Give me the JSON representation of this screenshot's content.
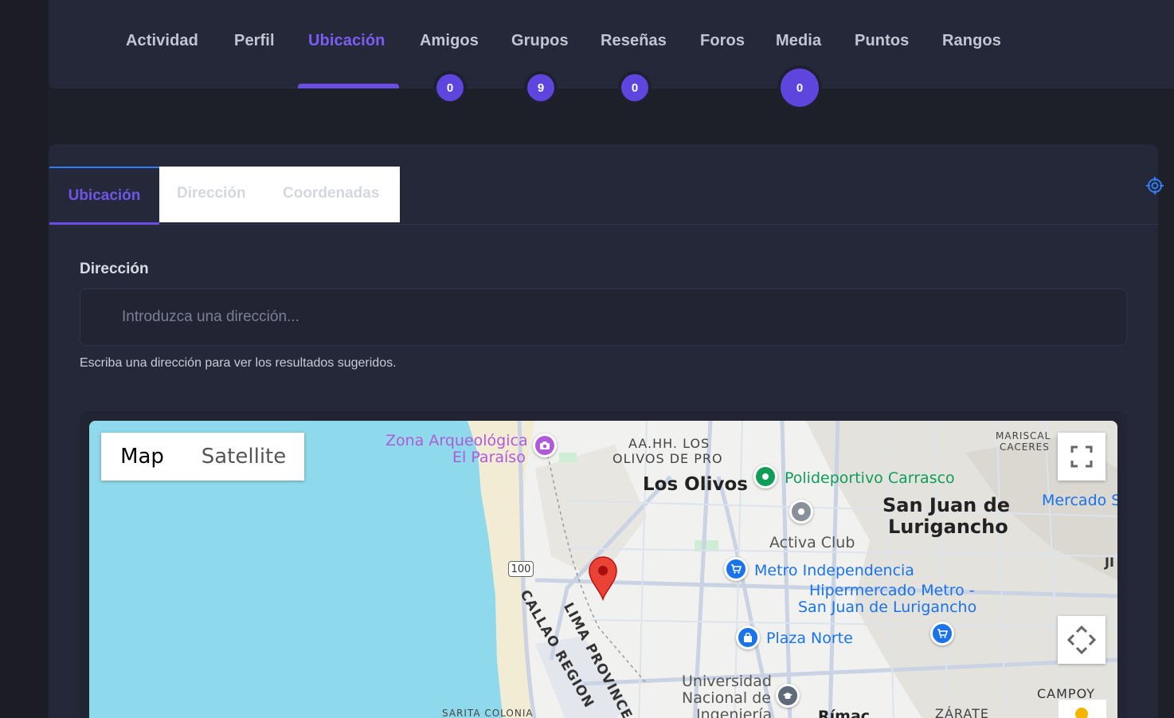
{
  "nav": {
    "items": [
      {
        "label": "Actividad"
      },
      {
        "label": "Perfil"
      },
      {
        "label": "Ubicación",
        "active": true
      },
      {
        "label": "Amigos",
        "badge": "0"
      },
      {
        "label": "Grupos",
        "badge": "9"
      },
      {
        "label": "Reseñas",
        "badge": "0"
      },
      {
        "label": "Foros"
      },
      {
        "label": "Media",
        "badge": "0"
      },
      {
        "label": "Puntos"
      },
      {
        "label": "Rangos"
      }
    ]
  },
  "location_tabs": {
    "active": "Ubicación",
    "items": [
      "Ubicación",
      "Dirección",
      "Coordenadas"
    ]
  },
  "form": {
    "address_label": "Dirección",
    "address_placeholder": "Introduzca una dirección...",
    "address_value": "",
    "help_text": "Escriba una dirección para ver los resultados sugeridos."
  },
  "map": {
    "type_buttons": [
      "Map",
      "Satellite"
    ],
    "selected_type": "Map",
    "labels": {
      "zona1": "Zona Arqueológica",
      "zona2": "El Paraíso",
      "aahh1": "AA.HH. LOS",
      "aahh2": "OLIVOS DE PRO",
      "los_olivos": "Los Olivos",
      "poli": "Polideportivo Carrasco",
      "sjl1": "San Juan de",
      "sjl2": "Lurigancho",
      "mariscal1": "MARISCAL",
      "mariscal2": "CACERES",
      "mercado": "Mercado S",
      "ji": "JI",
      "activa": "Activa Club",
      "metro_ind": "Metro Independencia",
      "hiper1": "Hipermercado Metro -",
      "hiper2": "San Juan de Lurigancho",
      "plaza": "Plaza Norte",
      "lima": "LIMA PROVINCE",
      "callao": "CALLAO REGION",
      "route": "100",
      "uni1": "Universidad",
      "uni2": "Nacional de",
      "uni3": "Ingeniería",
      "rimac": "Rímac",
      "zarate": "ZÁRATE",
      "campoy": "CAMPOY",
      "sarita": "SARITA COLONIA"
    },
    "colors": {
      "water": "#8fd9ec",
      "land": "#f1f1ef",
      "road": "#c9d3e4",
      "marker": "#ea4335",
      "poi_blue": "#1a73e8",
      "poi_green": "#0f9d58",
      "poi_purple": "#b05ad8"
    }
  },
  "colors": {
    "accent": "#6b4ee6",
    "background": "#1d1f29",
    "card": "#252838"
  }
}
